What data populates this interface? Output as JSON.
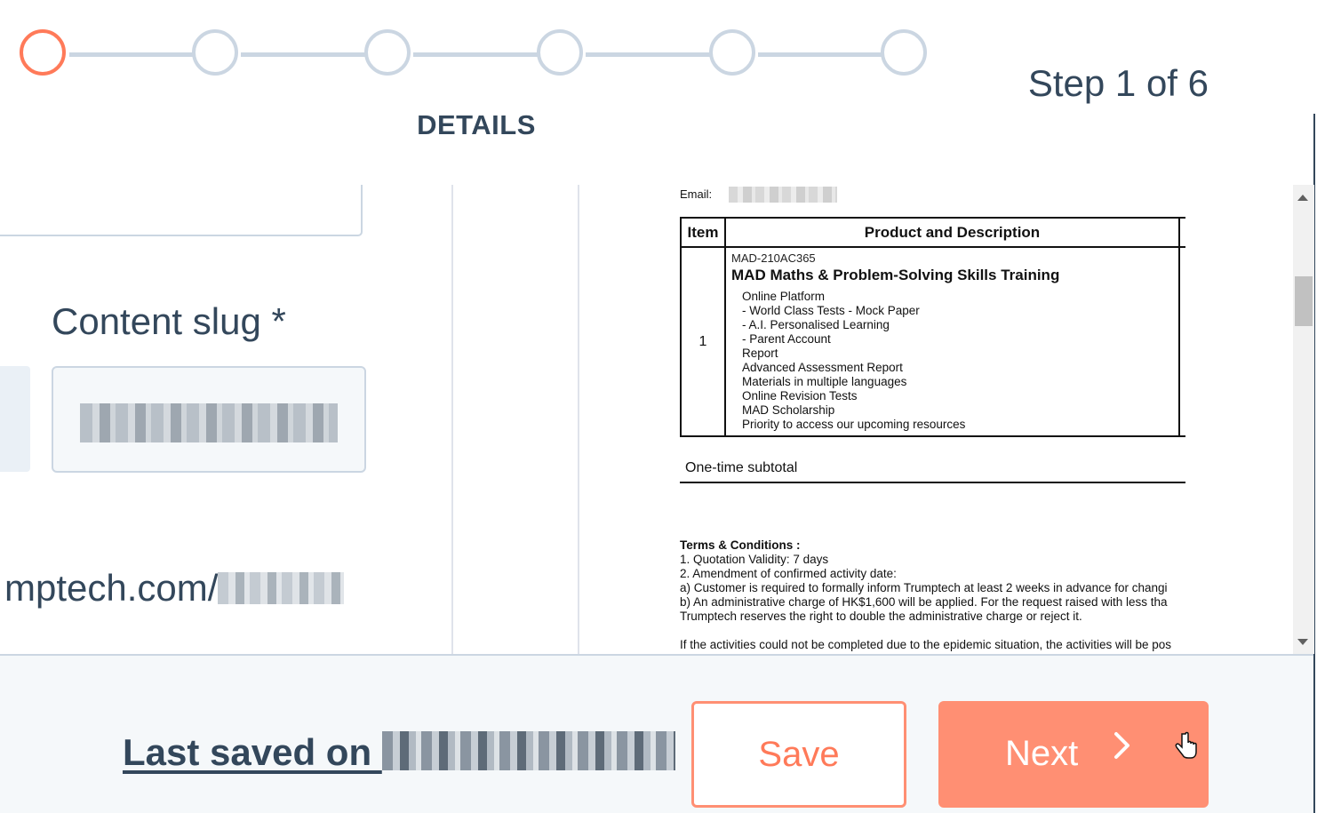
{
  "stepper": {
    "steps": 6,
    "current_step": 1,
    "current_label": "DETAILS",
    "counter_text": "Step 1 of 6",
    "active_color": "#ff7a59",
    "inactive_color": "#cbd6e2"
  },
  "form": {
    "slug_label": "Content slug *",
    "prefix_fragment": "",
    "url_prefix": "mptech.com/"
  },
  "preview": {
    "email_label": "Email:",
    "table": {
      "headers": [
        "Item",
        "Product and Description"
      ],
      "row": {
        "item": "1",
        "sku": "MAD-210AC365",
        "name": "MAD Maths & Problem-Solving Skills Training",
        "features": [
          "Online Platform",
          "- World Class Tests - Mock Paper",
          "- A.I. Personalised Learning",
          "- Parent Account",
          "Report",
          "Advanced Assessment Report",
          "Materials in multiple languages",
          "Online Revision Tests",
          "MAD Scholarship",
          "Priority to access our upcoming resources"
        ]
      }
    },
    "subtotal_label": "One-time subtotal",
    "terms": {
      "title": "Terms & Conditions :",
      "lines": [
        "1. Quotation Validity: 7 days",
        "2. Amendment of confirmed activity date:",
        "a) Customer is required to formally inform Trumptech at least 2 weeks in advance for changi",
        "b) An administrative charge of HK$1,600 will be applied. For the request raised with less tha",
        "Trumptech reserves the right to double the administrative charge or reject it.",
        "",
        "If the activities could not be completed due to the epidemic situation, the activities will be pos"
      ]
    }
  },
  "footer": {
    "last_saved_label": "Last saved on ",
    "save_label": "Save",
    "next_label": "Next",
    "next_icon": "chevron-right-icon"
  }
}
